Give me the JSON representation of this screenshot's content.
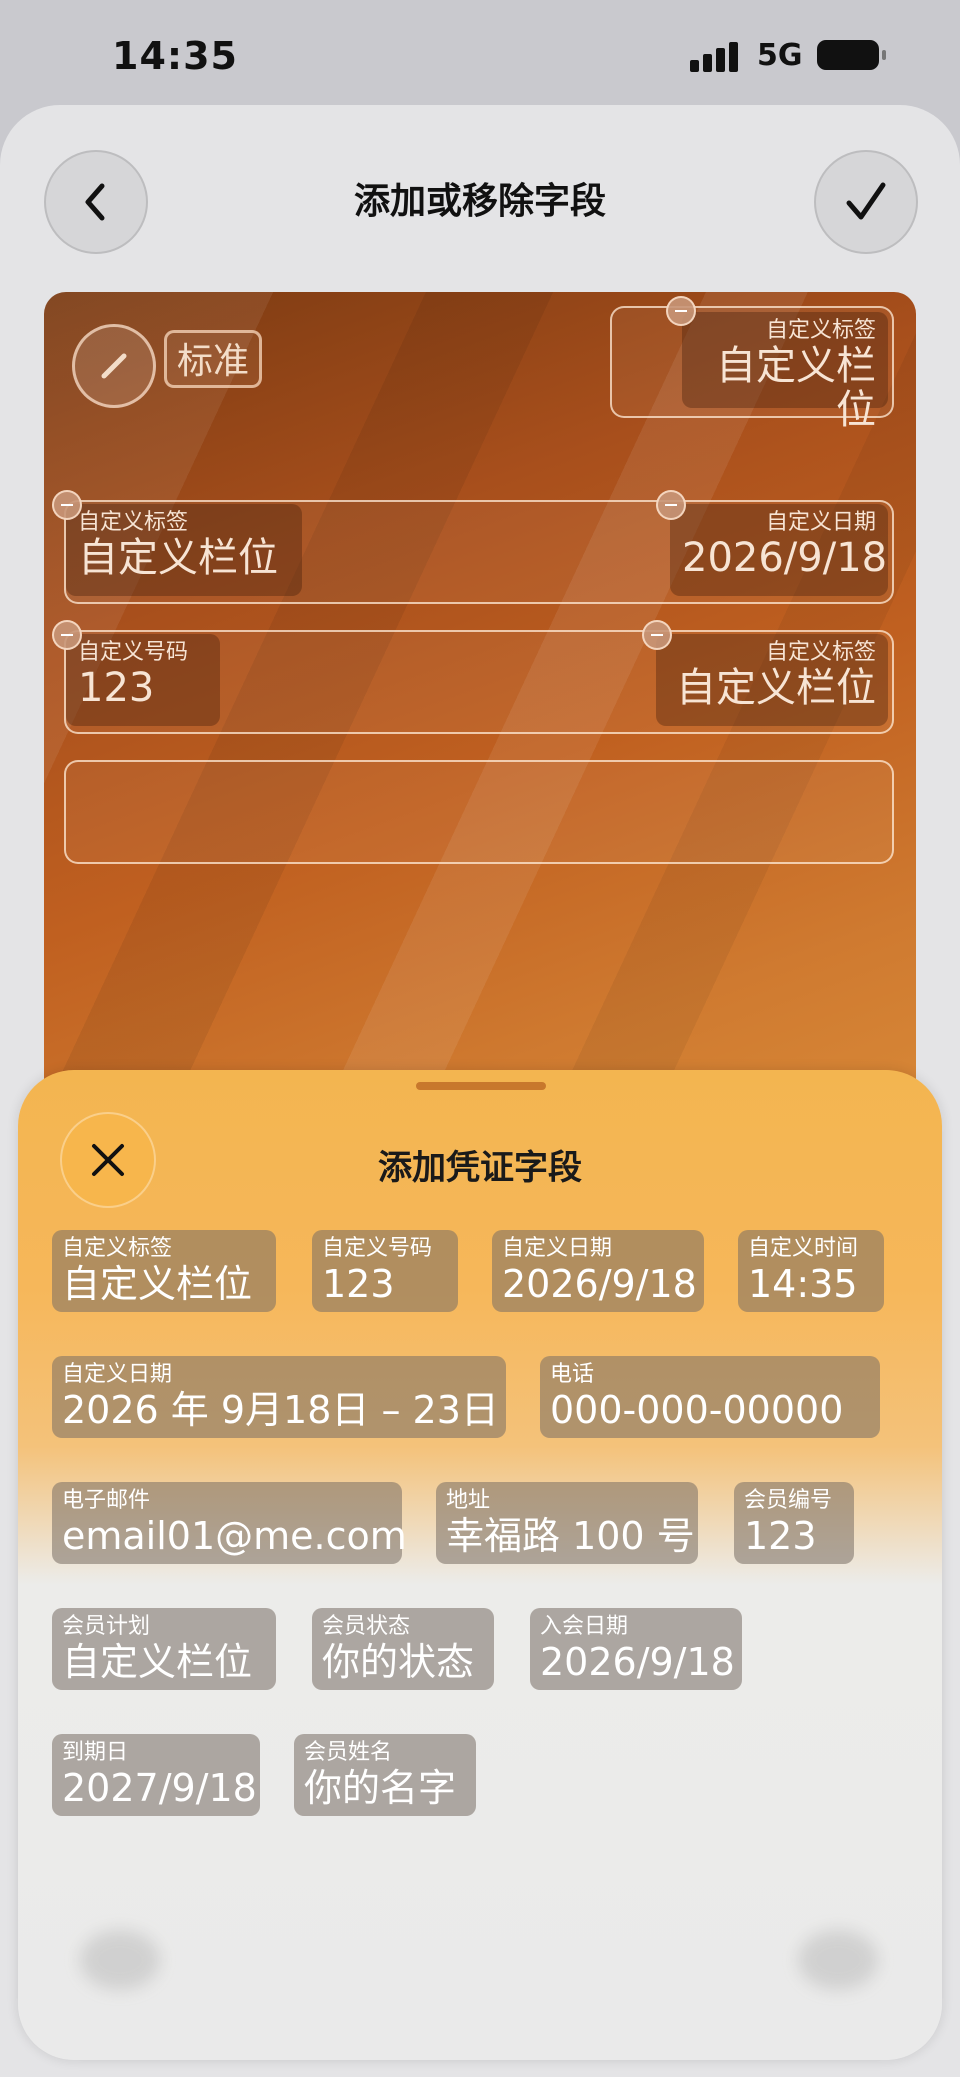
{
  "status_bar": {
    "time": "14:35",
    "network": "5G"
  },
  "nav": {
    "title": "添加或移除字段"
  },
  "card": {
    "badge": "标准",
    "fields": {
      "top_right": {
        "label": "自定义标签",
        "value": "自定义栏位"
      },
      "row1_left": {
        "label": "自定义标签",
        "value": "自定义栏位"
      },
      "row1_right": {
        "label": "自定义日期",
        "value": "2026/9/18"
      },
      "row2_left": {
        "label": "自定义号码",
        "value": "123"
      },
      "row2_right": {
        "label": "自定义标签",
        "value": "自定义栏位"
      }
    }
  },
  "panel": {
    "title": "添加凭证字段",
    "chips": [
      {
        "label": "自定义标签",
        "value": "自定义栏位"
      },
      {
        "label": "自定义号码",
        "value": "123"
      },
      {
        "label": "自定义日期",
        "value": "2026/9/18"
      },
      {
        "label": "自定义时间",
        "value": "14:35"
      },
      {
        "label": "自定义日期",
        "value": "2026 年 9月18日 – 23日"
      },
      {
        "label": "电话",
        "value": "000-000-00000"
      },
      {
        "label": "电子邮件",
        "value": "email01@me.com"
      },
      {
        "label": "地址",
        "value": "幸福路 100 号"
      },
      {
        "label": "会员编号",
        "value": "123"
      },
      {
        "label": "会员计划",
        "value": "自定义栏位"
      },
      {
        "label": "会员状态",
        "value": "你的状态"
      },
      {
        "label": "入会日期",
        "value": "2026/9/18"
      },
      {
        "label": "到期日",
        "value": "2027/9/18"
      },
      {
        "label": "会员姓名",
        "value": "你的名字"
      }
    ]
  }
}
